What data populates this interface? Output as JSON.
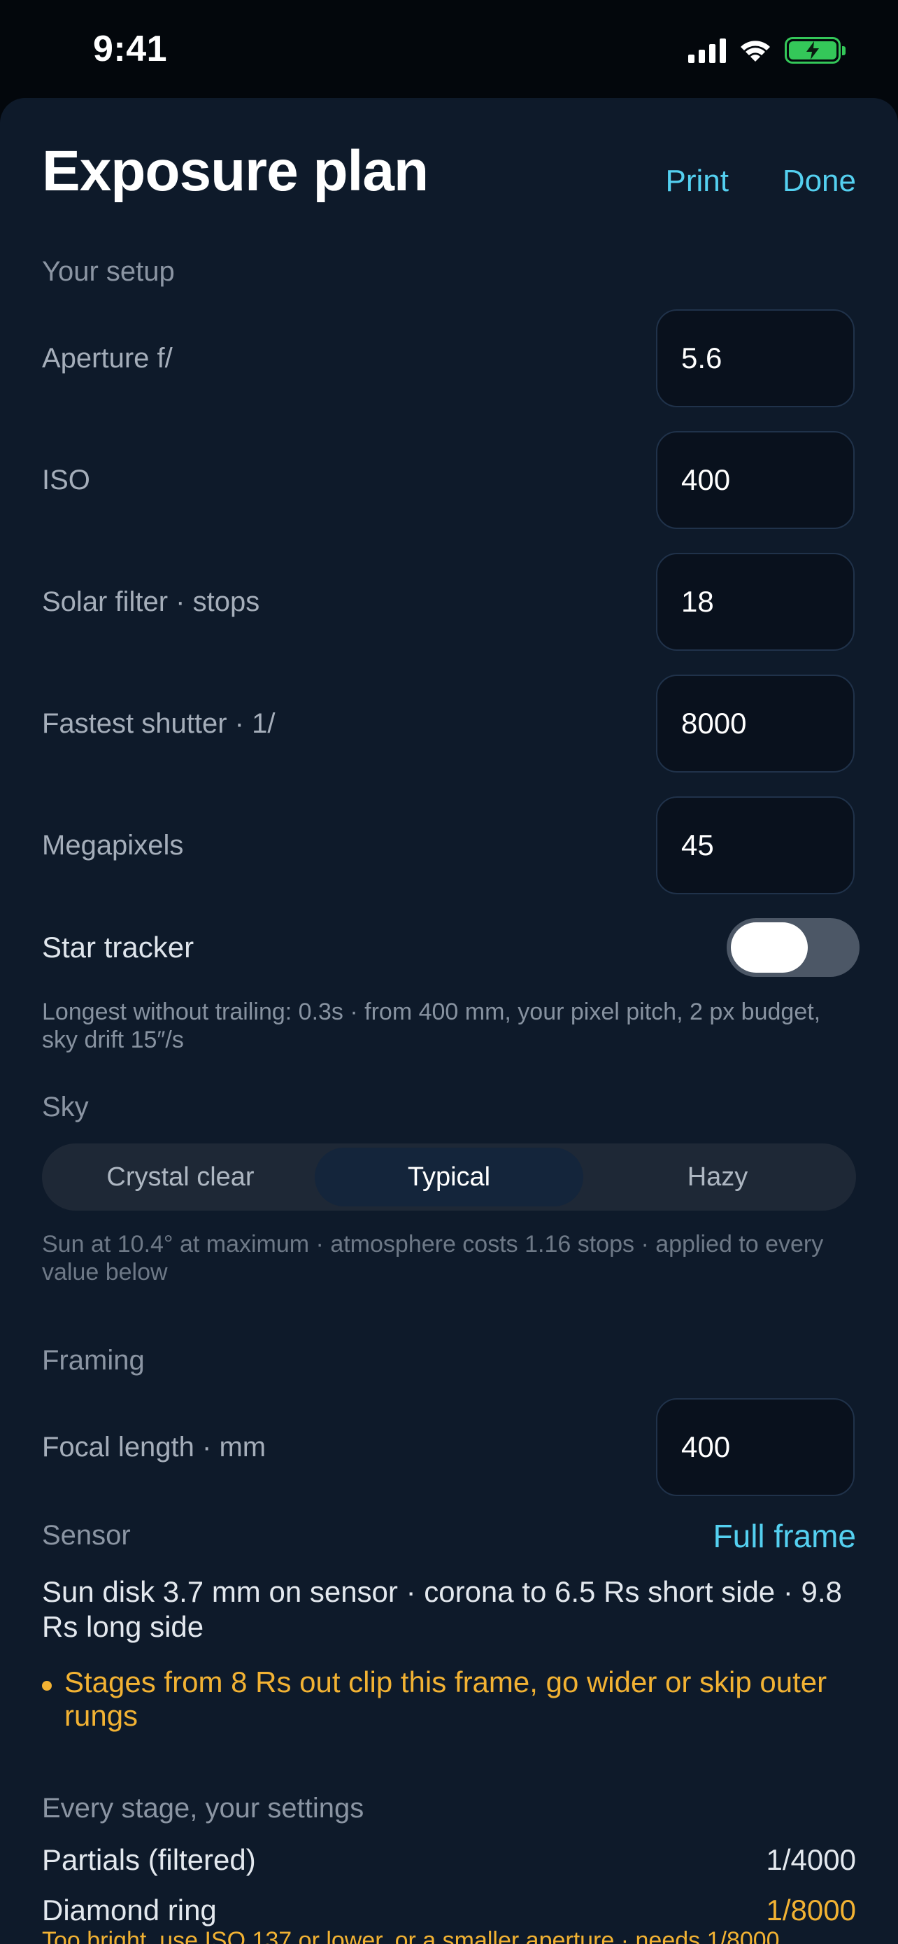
{
  "status_bar": {
    "time": "9:41"
  },
  "header": {
    "title": "Exposure plan",
    "print_label": "Print",
    "done_label": "Done"
  },
  "setup": {
    "section_label": "Your setup",
    "fields": [
      {
        "label": "Aperture f/",
        "value": "5.6"
      },
      {
        "label": "ISO",
        "value": "400"
      },
      {
        "label": "Solar filter · stops",
        "value": "18"
      },
      {
        "label": "Fastest shutter · 1/",
        "value": "8000"
      },
      {
        "label": "Megapixels",
        "value": "45"
      }
    ],
    "star_tracker": {
      "label": "Star tracker",
      "enabled": false
    },
    "tracker_note": "Longest without trailing: 0.3s · from 400 mm, your pixel pitch, 2 px budget, sky drift 15″/s"
  },
  "sky": {
    "section_label": "Sky",
    "options": [
      "Crystal clear",
      "Typical",
      "Hazy"
    ],
    "selected": "Typical",
    "note": "Sun at 10.4° at maximum · atmosphere costs 1.16 stops · applied to every value below"
  },
  "framing": {
    "section_label": "Framing",
    "focal_length": {
      "label": "Focal length · mm",
      "value": "400"
    },
    "sensor": {
      "label": "Sensor",
      "value": "Full frame"
    },
    "summary": "Sun disk 3.7 mm on sensor · corona to 6.5 Rs short side · 9.8 Rs long side",
    "warning": "Stages from 8 Rs out clip this frame, go wider or skip outer rungs"
  },
  "stages": {
    "section_label": "Every stage, your settings",
    "rows": [
      {
        "name": "Partials (filtered)",
        "value": "1/4000"
      },
      {
        "name": "Diamond ring",
        "value": "1/8000"
      }
    ],
    "diamond_warning": "Too bright, use ISO 137 or lower, or a smaller aperture · needs 1/8000"
  },
  "colors": {
    "accent": "#54d0f0",
    "warning": "#f2b233",
    "sheet_background": "#0e1a2a",
    "battery": "#34c759"
  }
}
